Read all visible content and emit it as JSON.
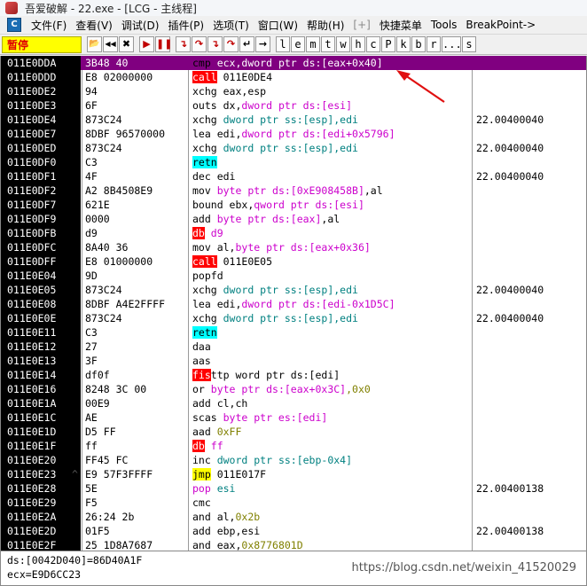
{
  "window": {
    "title": "吾爱破解 - 22.exe - [LCG - 主线程]"
  },
  "menu": [
    {
      "label": "文件(F)"
    },
    {
      "label": "查看(V)"
    },
    {
      "label": "调试(D)"
    },
    {
      "label": "插件(P)"
    },
    {
      "label": "选项(T)"
    },
    {
      "label": "窗口(W)"
    },
    {
      "label": "帮助(H)"
    },
    {
      "label": "[+]",
      "dim": true
    },
    {
      "label": "快捷菜单"
    },
    {
      "label": "Tools"
    },
    {
      "label": "BreakPoint->"
    }
  ],
  "toolbar": {
    "status": "暂停",
    "buttons": [
      "open-icon",
      "rewind-icon",
      "close-icon",
      "run-icon",
      "pause-icon",
      "step-into-icon",
      "step-over-icon",
      "trace-into-icon",
      "trace-over-icon",
      "execute-till-return-icon",
      "go-to-icon"
    ],
    "letters": [
      "l",
      "e",
      "m",
      "t",
      "w",
      "h",
      "c",
      "P",
      "k",
      "b",
      "r",
      "...",
      "s"
    ]
  },
  "rows": [
    {
      "addr": "011E0DDA",
      "hex": "3B48 40",
      "sel": true,
      "dis": [
        {
          "t": "cmp ",
          "c": "black"
        },
        {
          "t": "ecx",
          "c": "mag"
        },
        {
          "t": ",dword ptr ds:[eax+0x40]",
          "c": "mag"
        }
      ]
    },
    {
      "addr": "011E0DDD",
      "hex": "E8 02000000",
      "dis": [
        {
          "t": "call",
          "c": "red-bg"
        },
        {
          "t": " 011E0DE4",
          "c": "black"
        }
      ]
    },
    {
      "addr": "011E0DE2",
      "hex": "94",
      "dis": [
        {
          "t": "xchg ",
          "c": "black"
        },
        {
          "t": "eax,esp",
          "c": "black"
        }
      ]
    },
    {
      "addr": "011E0DE3",
      "hex": "6F",
      "dis": [
        {
          "t": "outs ",
          "c": "black"
        },
        {
          "t": "dx,",
          "c": "black"
        },
        {
          "t": "dword ptr ds:[esi]",
          "c": "mag"
        }
      ]
    },
    {
      "addr": "011E0DE4",
      "hex": "873C24",
      "cmt": "22.00400040",
      "dis": [
        {
          "t": "xchg ",
          "c": "black"
        },
        {
          "t": "dword ptr ss:[esp]",
          "c": "teal"
        },
        {
          "t": ",edi",
          "c": "teal"
        }
      ]
    },
    {
      "addr": "011E0DE7",
      "hex": "8DBF 96570000",
      "dis": [
        {
          "t": "lea ",
          "c": "black"
        },
        {
          "t": "edi,",
          "c": "black"
        },
        {
          "t": "dword ptr ds:[edi+0x5796]",
          "c": "mag"
        }
      ]
    },
    {
      "addr": "011E0DED",
      "hex": "873C24",
      "cmt": "22.00400040",
      "dis": [
        {
          "t": "xchg ",
          "c": "black"
        },
        {
          "t": "dword ptr ss:[esp]",
          "c": "teal"
        },
        {
          "t": ",edi",
          "c": "teal"
        }
      ]
    },
    {
      "addr": "011E0DF0",
      "hex": "C3",
      "dis": [
        {
          "t": "retn",
          "c": "cyan-bg"
        }
      ]
    },
    {
      "addr": "011E0DF1",
      "hex": "4F",
      "cmt": "22.00400040",
      "dis": [
        {
          "t": "dec ",
          "c": "black"
        },
        {
          "t": "edi",
          "c": "black"
        }
      ]
    },
    {
      "addr": "011E0DF2",
      "hex": "A2 8B4508E9",
      "dis": [
        {
          "t": "mov ",
          "c": "black"
        },
        {
          "t": "byte ptr ds:[0xE908458B]",
          "c": "mag"
        },
        {
          "t": ",al",
          "c": "black"
        }
      ]
    },
    {
      "addr": "011E0DF7",
      "hex": "621E",
      "dis": [
        {
          "t": "bound ",
          "c": "black"
        },
        {
          "t": "ebx,",
          "c": "black"
        },
        {
          "t": "qword ptr ds:[esi]",
          "c": "mag"
        }
      ]
    },
    {
      "addr": "011E0DF9",
      "hex": "0000",
      "dis": [
        {
          "t": "add ",
          "c": "black"
        },
        {
          "t": "byte ptr ds:[eax]",
          "c": "mag"
        },
        {
          "t": ",al",
          "c": "black"
        }
      ]
    },
    {
      "addr": "011E0DFB",
      "hex": "d9",
      "dis": [
        {
          "t": "db",
          "c": "red-bg"
        },
        {
          "t": " d9",
          "c": "mag"
        }
      ]
    },
    {
      "addr": "011E0DFC",
      "hex": "8A40 36",
      "dis": [
        {
          "t": "mov ",
          "c": "black"
        },
        {
          "t": "al,",
          "c": "black"
        },
        {
          "t": "byte ptr ds:[eax+0x36]",
          "c": "mag"
        }
      ]
    },
    {
      "addr": "011E0DFF",
      "hex": "E8 01000000",
      "dis": [
        {
          "t": "call",
          "c": "red-bg"
        },
        {
          "t": " 011E0E05",
          "c": "black"
        }
      ]
    },
    {
      "addr": "011E0E04",
      "hex": "9D",
      "dis": [
        {
          "t": "popfd",
          "c": "black"
        }
      ]
    },
    {
      "addr": "011E0E05",
      "hex": "873C24",
      "cmt": "22.00400040",
      "dis": [
        {
          "t": "xchg ",
          "c": "black"
        },
        {
          "t": "dword ptr ss:[esp]",
          "c": "teal"
        },
        {
          "t": ",edi",
          "c": "teal"
        }
      ]
    },
    {
      "addr": "011E0E08",
      "hex": "8DBF A4E2FFFF",
      "dis": [
        {
          "t": "lea ",
          "c": "black"
        },
        {
          "t": "edi,",
          "c": "black"
        },
        {
          "t": "dword ptr ds:[edi-0x1D5C]",
          "c": "mag"
        }
      ]
    },
    {
      "addr": "011E0E0E",
      "hex": "873C24",
      "cmt": "22.00400040",
      "dis": [
        {
          "t": "xchg ",
          "c": "black"
        },
        {
          "t": "dword ptr ss:[esp]",
          "c": "teal"
        },
        {
          "t": ",edi",
          "c": "teal"
        }
      ]
    },
    {
      "addr": "011E0E11",
      "hex": "C3",
      "dis": [
        {
          "t": "retn",
          "c": "cyan-bg"
        }
      ]
    },
    {
      "addr": "011E0E12",
      "hex": "27",
      "dis": [
        {
          "t": "daa",
          "c": "black"
        }
      ]
    },
    {
      "addr": "011E0E13",
      "hex": "3F",
      "dis": [
        {
          "t": "aas",
          "c": "black"
        }
      ]
    },
    {
      "addr": "011E0E14",
      "hex": "df0f",
      "dis": [
        {
          "t": "fis",
          "c": "red-bg"
        },
        {
          "t": "ttp word ptr ds:[edi]",
          "c": "black"
        }
      ]
    },
    {
      "addr": "011E0E16",
      "hex": "8248 3C 00",
      "dis": [
        {
          "t": "or ",
          "c": "black"
        },
        {
          "t": "byte ptr ds:[eax+0x3C]",
          "c": "mag"
        },
        {
          "t": ",0x0",
          "c": "olive"
        }
      ]
    },
    {
      "addr": "011E0E1A",
      "hex": "00E9",
      "dis": [
        {
          "t": "add ",
          "c": "black"
        },
        {
          "t": "cl,ch",
          "c": "black"
        }
      ]
    },
    {
      "addr": "011E0E1C",
      "hex": "AE",
      "dis": [
        {
          "t": "scas ",
          "c": "black"
        },
        {
          "t": "byte ptr es:[edi]",
          "c": "mag"
        }
      ]
    },
    {
      "addr": "011E0E1D",
      "hex": "D5 FF",
      "dis": [
        {
          "t": "aad ",
          "c": "black"
        },
        {
          "t": "0xFF",
          "c": "olive"
        }
      ]
    },
    {
      "addr": "011E0E1F",
      "hex": "ff",
      "dis": [
        {
          "t": "db",
          "c": "red-bg"
        },
        {
          "t": " ff",
          "c": "mag"
        }
      ]
    },
    {
      "addr": "011E0E20",
      "hex": "FF45 FC",
      "dis": [
        {
          "t": "inc ",
          "c": "black"
        },
        {
          "t": "dword ptr ss:[ebp-0x4]",
          "c": "teal"
        }
      ]
    },
    {
      "addr": "011E0E23",
      "hex": "E9 57F3FFFF",
      "mark": "^",
      "dis": [
        {
          "t": "jmp",
          "c": "yellow-bg"
        },
        {
          "t": " 011E017F",
          "c": "black"
        }
      ]
    },
    {
      "addr": "011E0E28",
      "hex": "5E",
      "cmt": "22.00400138",
      "dis": [
        {
          "t": "pop ",
          "c": "mag"
        },
        {
          "t": "esi",
          "c": "teal"
        }
      ]
    },
    {
      "addr": "011E0E29",
      "hex": "F5",
      "dis": [
        {
          "t": "cmc",
          "c": "black"
        }
      ]
    },
    {
      "addr": "011E0E2A",
      "hex": "26:24 2b",
      "dis": [
        {
          "t": "and ",
          "c": "black"
        },
        {
          "t": "al,",
          "c": "black"
        },
        {
          "t": "0x2b",
          "c": "olive"
        }
      ]
    },
    {
      "addr": "011E0E2D",
      "hex": "01F5",
      "cmt": "22.00400138",
      "dis": [
        {
          "t": "add ",
          "c": "black"
        },
        {
          "t": "ebp,esi",
          "c": "black"
        }
      ]
    },
    {
      "addr": "011E0E2F",
      "hex": "25 1D8A7687",
      "dis": [
        {
          "t": "and ",
          "c": "black"
        },
        {
          "t": "eax,",
          "c": "black"
        },
        {
          "t": "0x8776801D",
          "c": "olive"
        }
      ]
    }
  ],
  "info": {
    "line1": "ds:[0042D040]=86D40A1F",
    "line2": "ecx=E9D6CC23"
  },
  "watermark": "https://blog.csdn.net/weixin_41520029",
  "colors": {
    "selection": "#800080",
    "call": "#ff0000",
    "retn": "#00ffff",
    "jmp": "#ffff00",
    "memref": "#cc00cc",
    "stackref": "#008080",
    "immediate": "#808000"
  }
}
